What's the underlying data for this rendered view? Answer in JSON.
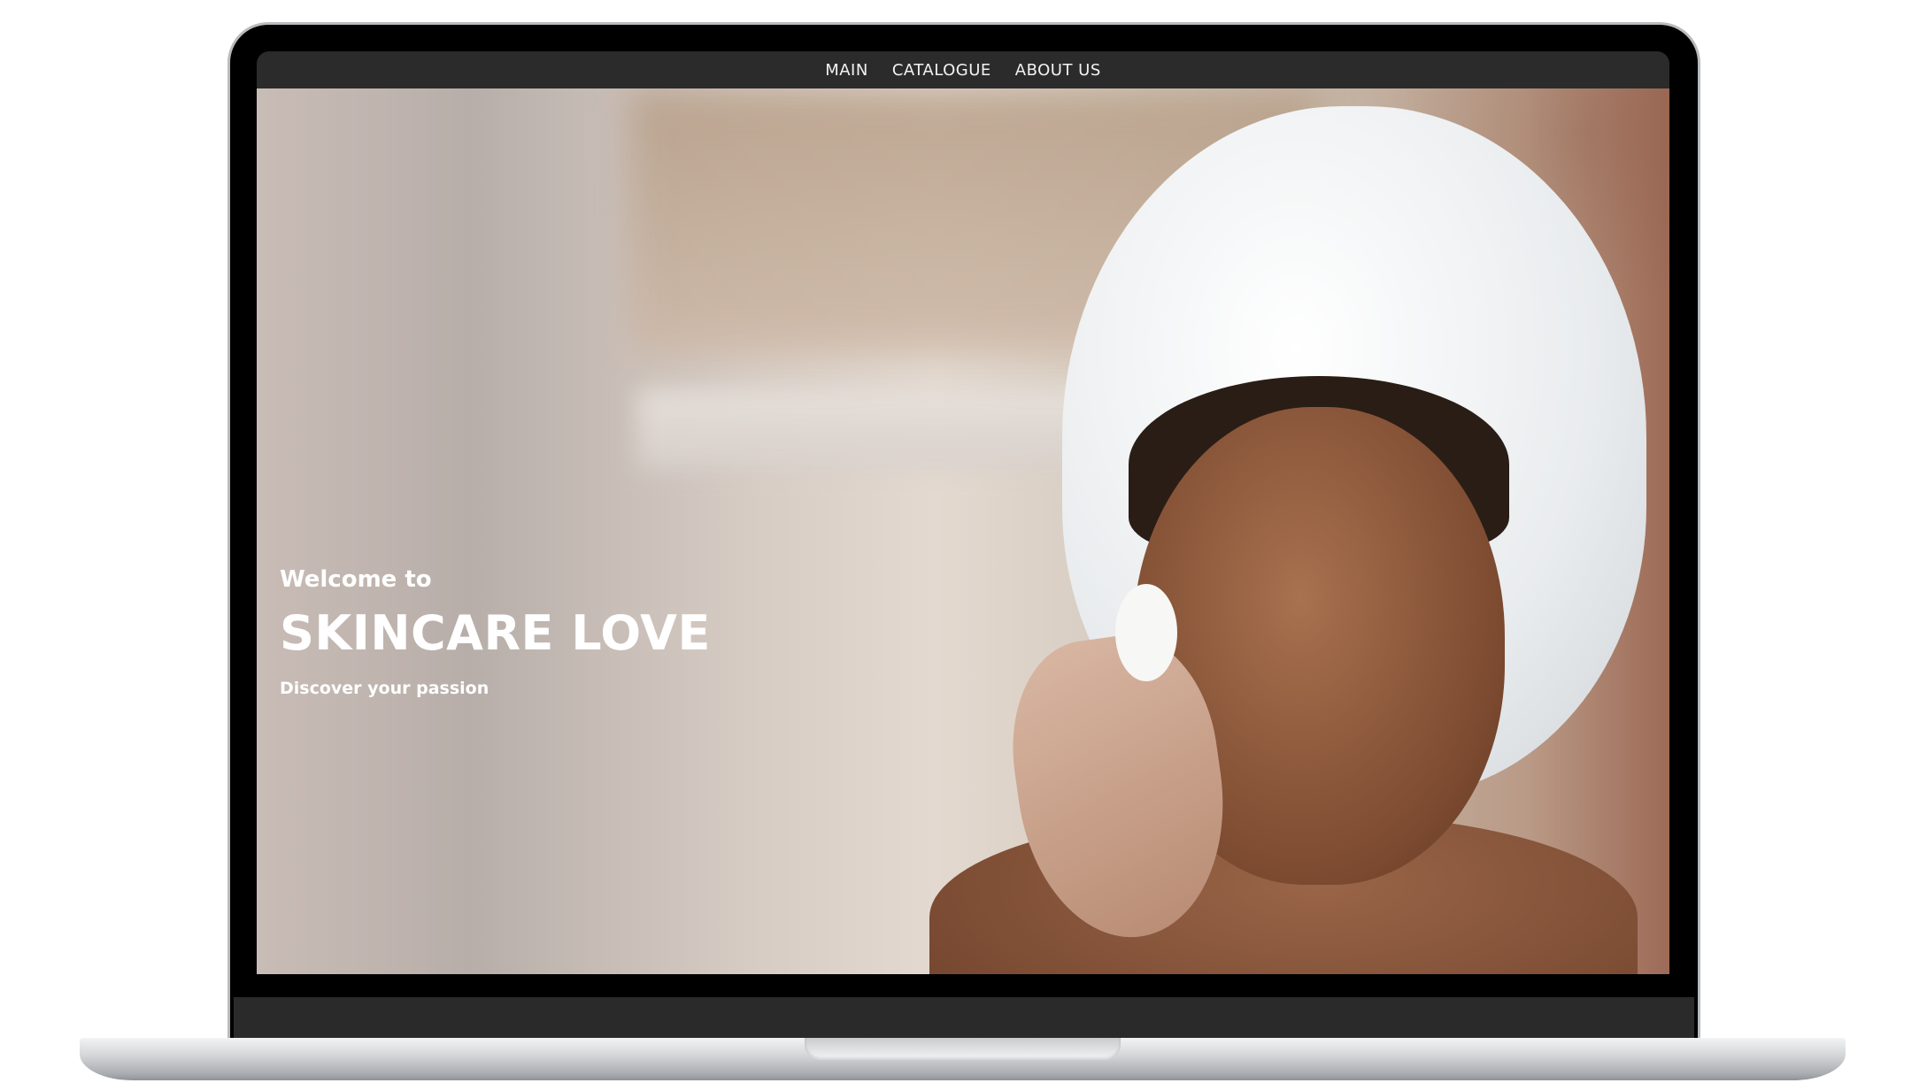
{
  "nav": {
    "items": [
      {
        "label": "MAIN"
      },
      {
        "label": "CATALOGUE"
      },
      {
        "label": "ABOUT US"
      }
    ]
  },
  "hero": {
    "welcome": "Welcome to",
    "title": "SKINCARE LOVE",
    "subtitle": "Discover your passion"
  }
}
